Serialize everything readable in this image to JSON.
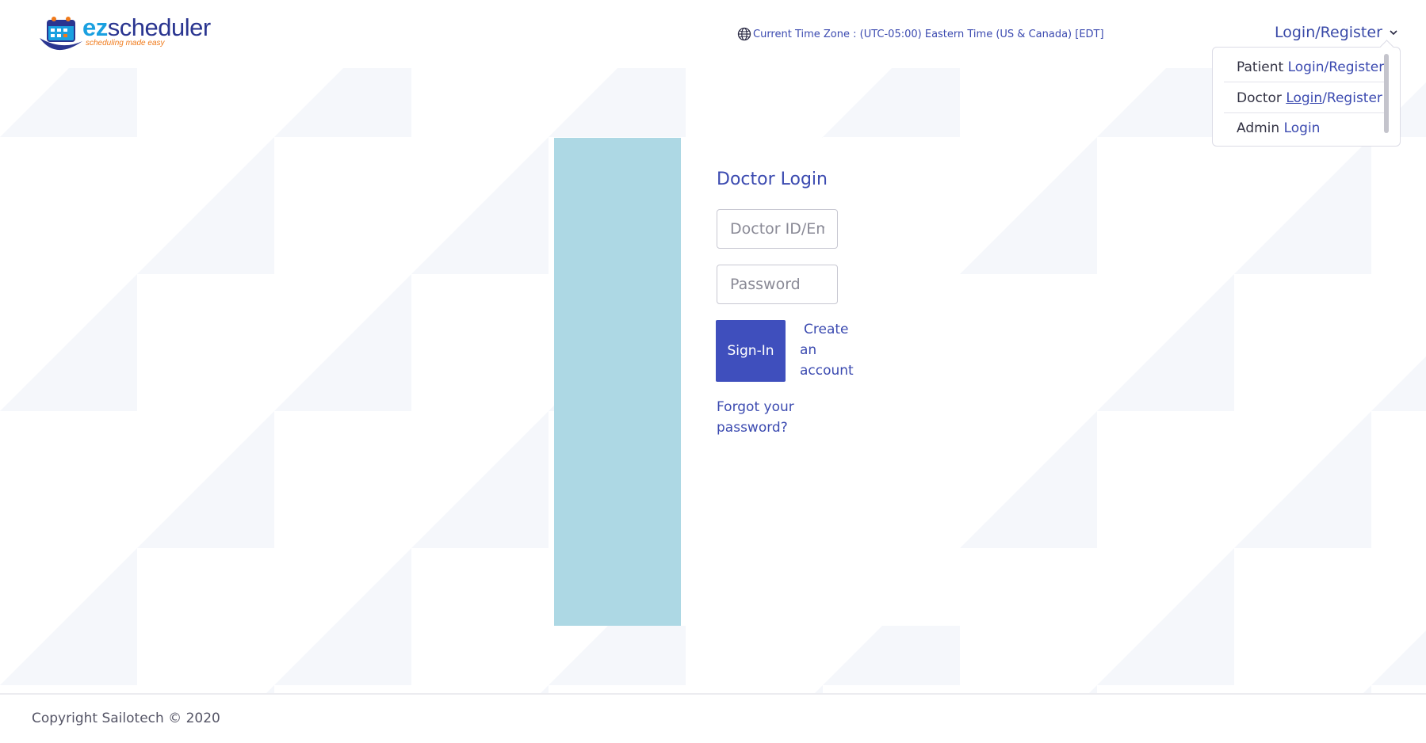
{
  "brand": {
    "name_prefix": "ez",
    "name_suffix": "scheduler",
    "tagline": "scheduling made easy"
  },
  "header": {
    "timezone_text": "Current Time Zone : (UTC-05:00) Eastern Time (US & Canada) [EDT]",
    "login_register_label": "Login/Register"
  },
  "dropdown": {
    "items": [
      {
        "role": "Patient",
        "login": "Login",
        "separator": "/",
        "register": "Register"
      },
      {
        "role": "Doctor",
        "login": "Login",
        "separator": "/",
        "register": "Register"
      },
      {
        "role": "Admin",
        "login": "Login"
      }
    ]
  },
  "login_form": {
    "title": "Doctor Login",
    "id_placeholder": "Doctor ID/Email",
    "password_placeholder": "Password",
    "sign_in_label": "Sign-In",
    "create_account_label": "Create an account",
    "forgot_password_label": "Forgot your password?"
  },
  "footer": {
    "copyright": "Copyright Sailotech © 2020"
  },
  "colors": {
    "primary": "#3f4fbd",
    "link": "#3b4ab0",
    "image_panel": "#add8e4",
    "logo_blue": "#1aa0e0",
    "logo_navy": "#2a3590",
    "logo_orange": "#f07a1a"
  },
  "icons": {
    "timezone": "globe-icon",
    "login_register": "chevron-down-icon"
  }
}
